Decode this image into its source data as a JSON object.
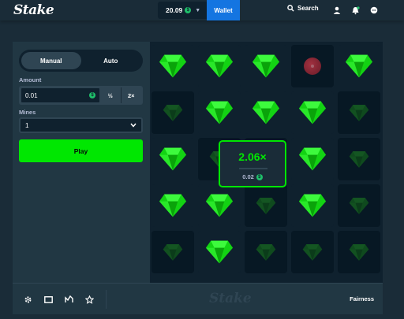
{
  "header": {
    "logo": "Stake",
    "balance": "20.09",
    "coin_symbol": "$",
    "wallet_label": "Wallet",
    "search_label": "Search",
    "icons": [
      "search-icon",
      "user-icon",
      "bell-icon",
      "chat-icon"
    ]
  },
  "controls": {
    "modes": [
      "Manual",
      "Auto"
    ],
    "active_mode": "Manual",
    "amount_label": "Amount",
    "amount_value": "0.01",
    "half_label": "½",
    "double_label": "2×",
    "mines_label": "Mines",
    "mines_value": "1",
    "play_label": "Play"
  },
  "board": {
    "columns": 5,
    "rows": 5,
    "tiles": [
      "gem",
      "gem",
      "gem",
      "mine",
      "gem",
      "gem-dim",
      "gem",
      "gem",
      "gem",
      "gem-dim",
      "gem",
      "gem-dim",
      "hidden",
      "gem",
      "gem-dim",
      "gem",
      "gem",
      "gem-dim",
      "gem",
      "gem-dim",
      "gem-dim",
      "gem",
      "gem-dim",
      "gem-dim",
      "gem-dim"
    ],
    "result": {
      "multiplier": "2.06×",
      "payout": "0.02"
    }
  },
  "footer": {
    "icons": [
      "gear-icon",
      "theatre-icon",
      "stats-icon",
      "star-icon"
    ],
    "logo": "Stake",
    "fairness_label": "Fairness"
  },
  "colors": {
    "background": "#1a2c38",
    "panel": "#213743",
    "board": "#0f212e",
    "accent_green": "#00e701",
    "wallet_blue": "#1475e1",
    "mine_red": "#d63a4a"
  }
}
